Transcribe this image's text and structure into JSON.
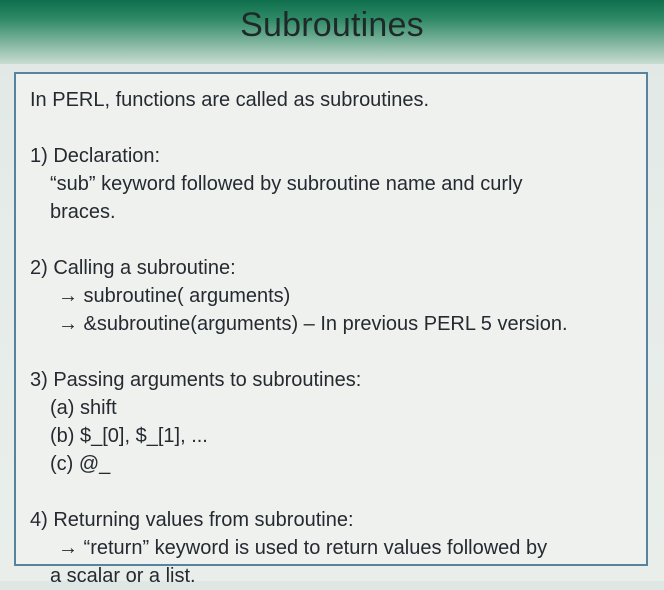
{
  "title": "Subroutines",
  "intro": "In PERL, functions are called as subroutines.",
  "section1": {
    "heading": "1) Declaration:",
    "line1": "“sub” keyword followed by subroutine name and curly",
    "line2": "braces."
  },
  "section2": {
    "heading": "2) Calling a subroutine:",
    "item1": "→ subroutine( arguments)",
    "item2": "→ &subroutine(arguments) – In previous PERL 5 version."
  },
  "section3": {
    "heading": "3) Passing arguments to subroutines:",
    "item1": "(a) shift",
    "item2": "(b) $_[0], $_[1], ...",
    "item3": "(c) @_"
  },
  "section4": {
    "heading": "4) Returning values from subroutine:",
    "line1": "→ “return” keyword is used to return values followed by",
    "line2": "a scalar or a list."
  }
}
